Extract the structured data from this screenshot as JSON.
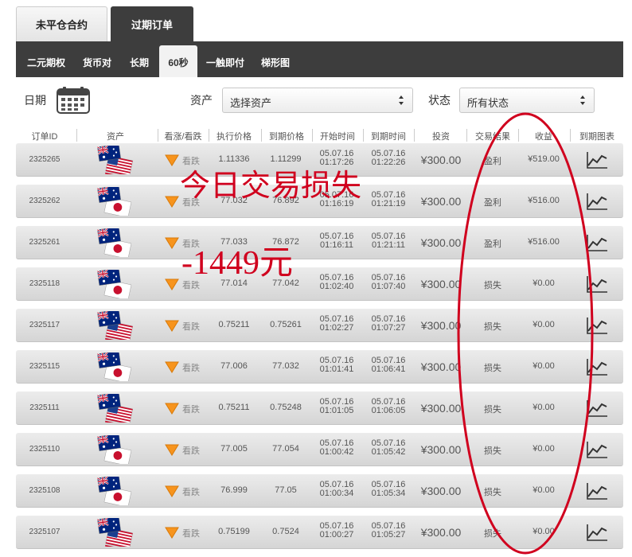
{
  "top_tabs": [
    {
      "label": "未平仓合约",
      "active": false
    },
    {
      "label": "过期订单",
      "active": true
    }
  ],
  "sub_tabs": [
    {
      "label": "二元期权",
      "active": false
    },
    {
      "label": "货币对",
      "active": false
    },
    {
      "label": "长期",
      "active": false
    },
    {
      "label": "60秒",
      "active": true
    },
    {
      "label": "一触即付",
      "active": false
    },
    {
      "label": "梯形图",
      "active": false
    }
  ],
  "filters": {
    "date_label": "日期",
    "asset_label": "资产",
    "asset_value": "选择资产",
    "status_label": "状态",
    "status_value": "所有状态"
  },
  "columns": {
    "id": "订单ID",
    "asset": "资产",
    "direction": "看涨/看跌",
    "exec_price": "执行价格",
    "expiry_price": "到期价格",
    "start_time": "开始时间",
    "expiry_time": "到期时间",
    "investment": "投资",
    "result": "交易结果",
    "payout": "收益",
    "chart": "到期图表"
  },
  "rows": [
    {
      "id": "2325265",
      "pair": "AUD/USD",
      "direction": "看跌",
      "exec": "1.11336",
      "expiry": "1.11299",
      "start_date": "05.07.16",
      "start_time": "01:17:26",
      "end_date": "05.07.16",
      "end_time": "01:22:26",
      "investment": "¥300.00",
      "result": "盈利",
      "payout": "¥519.00"
    },
    {
      "id": "2325262",
      "pair": "AUD/JPY",
      "direction": "看跌",
      "exec": "77.032",
      "expiry": "76.892",
      "start_date": "05.07.16",
      "start_time": "01:16:19",
      "end_date": "05.07.16",
      "end_time": "01:21:19",
      "investment": "¥300.00",
      "result": "盈利",
      "payout": "¥516.00"
    },
    {
      "id": "2325261",
      "pair": "AUD/JPY",
      "direction": "看跌",
      "exec": "77.033",
      "expiry": "76.872",
      "start_date": "05.07.16",
      "start_time": "01:16:11",
      "end_date": "05.07.16",
      "end_time": "01:21:11",
      "investment": "¥300.00",
      "result": "盈利",
      "payout": "¥516.00"
    },
    {
      "id": "2325118",
      "pair": "AUD/JPY",
      "direction": "看跌",
      "exec": "77.014",
      "expiry": "77.042",
      "start_date": "05.07.16",
      "start_time": "01:02:40",
      "end_date": "05.07.16",
      "end_time": "01:07:40",
      "investment": "¥300.00",
      "result": "损失",
      "payout": "¥0.00"
    },
    {
      "id": "2325117",
      "pair": "AUD/USD",
      "direction": "看跌",
      "exec": "0.75211",
      "expiry": "0.75261",
      "start_date": "05.07.16",
      "start_time": "01:02:27",
      "end_date": "05.07.16",
      "end_time": "01:07:27",
      "investment": "¥300.00",
      "result": "损失",
      "payout": "¥0.00"
    },
    {
      "id": "2325115",
      "pair": "AUD/JPY",
      "direction": "看跌",
      "exec": "77.006",
      "expiry": "77.032",
      "start_date": "05.07.16",
      "start_time": "01:01:41",
      "end_date": "05.07.16",
      "end_time": "01:06:41",
      "investment": "¥300.00",
      "result": "损失",
      "payout": "¥0.00"
    },
    {
      "id": "2325111",
      "pair": "AUD/USD",
      "direction": "看跌",
      "exec": "0.75211",
      "expiry": "0.75248",
      "start_date": "05.07.16",
      "start_time": "01:01:05",
      "end_date": "05.07.16",
      "end_time": "01:06:05",
      "investment": "¥300.00",
      "result": "损失",
      "payout": "¥0.00"
    },
    {
      "id": "2325110",
      "pair": "AUD/JPY",
      "direction": "看跌",
      "exec": "77.005",
      "expiry": "77.054",
      "start_date": "05.07.16",
      "start_time": "01:00:42",
      "end_date": "05.07.16",
      "end_time": "01:05:42",
      "investment": "¥300.00",
      "result": "损失",
      "payout": "¥0.00"
    },
    {
      "id": "2325108",
      "pair": "AUD/JPY",
      "direction": "看跌",
      "exec": "76.999",
      "expiry": "77.05",
      "start_date": "05.07.16",
      "start_time": "01:00:34",
      "end_date": "05.07.16",
      "end_time": "01:05:34",
      "investment": "¥300.00",
      "result": "损失",
      "payout": "¥0.00"
    },
    {
      "id": "2325107",
      "pair": "AUD/USD",
      "direction": "看跌",
      "exec": "0.75199",
      "expiry": "0.7524",
      "start_date": "05.07.16",
      "start_time": "01:00:27",
      "end_date": "05.07.16",
      "end_time": "01:05:27",
      "investment": "¥300.00",
      "result": "损失",
      "payout": "¥0.00"
    }
  ],
  "annotation": {
    "line1": "今日交易损失",
    "line2": "-1449元",
    "color": "#d0001e"
  }
}
